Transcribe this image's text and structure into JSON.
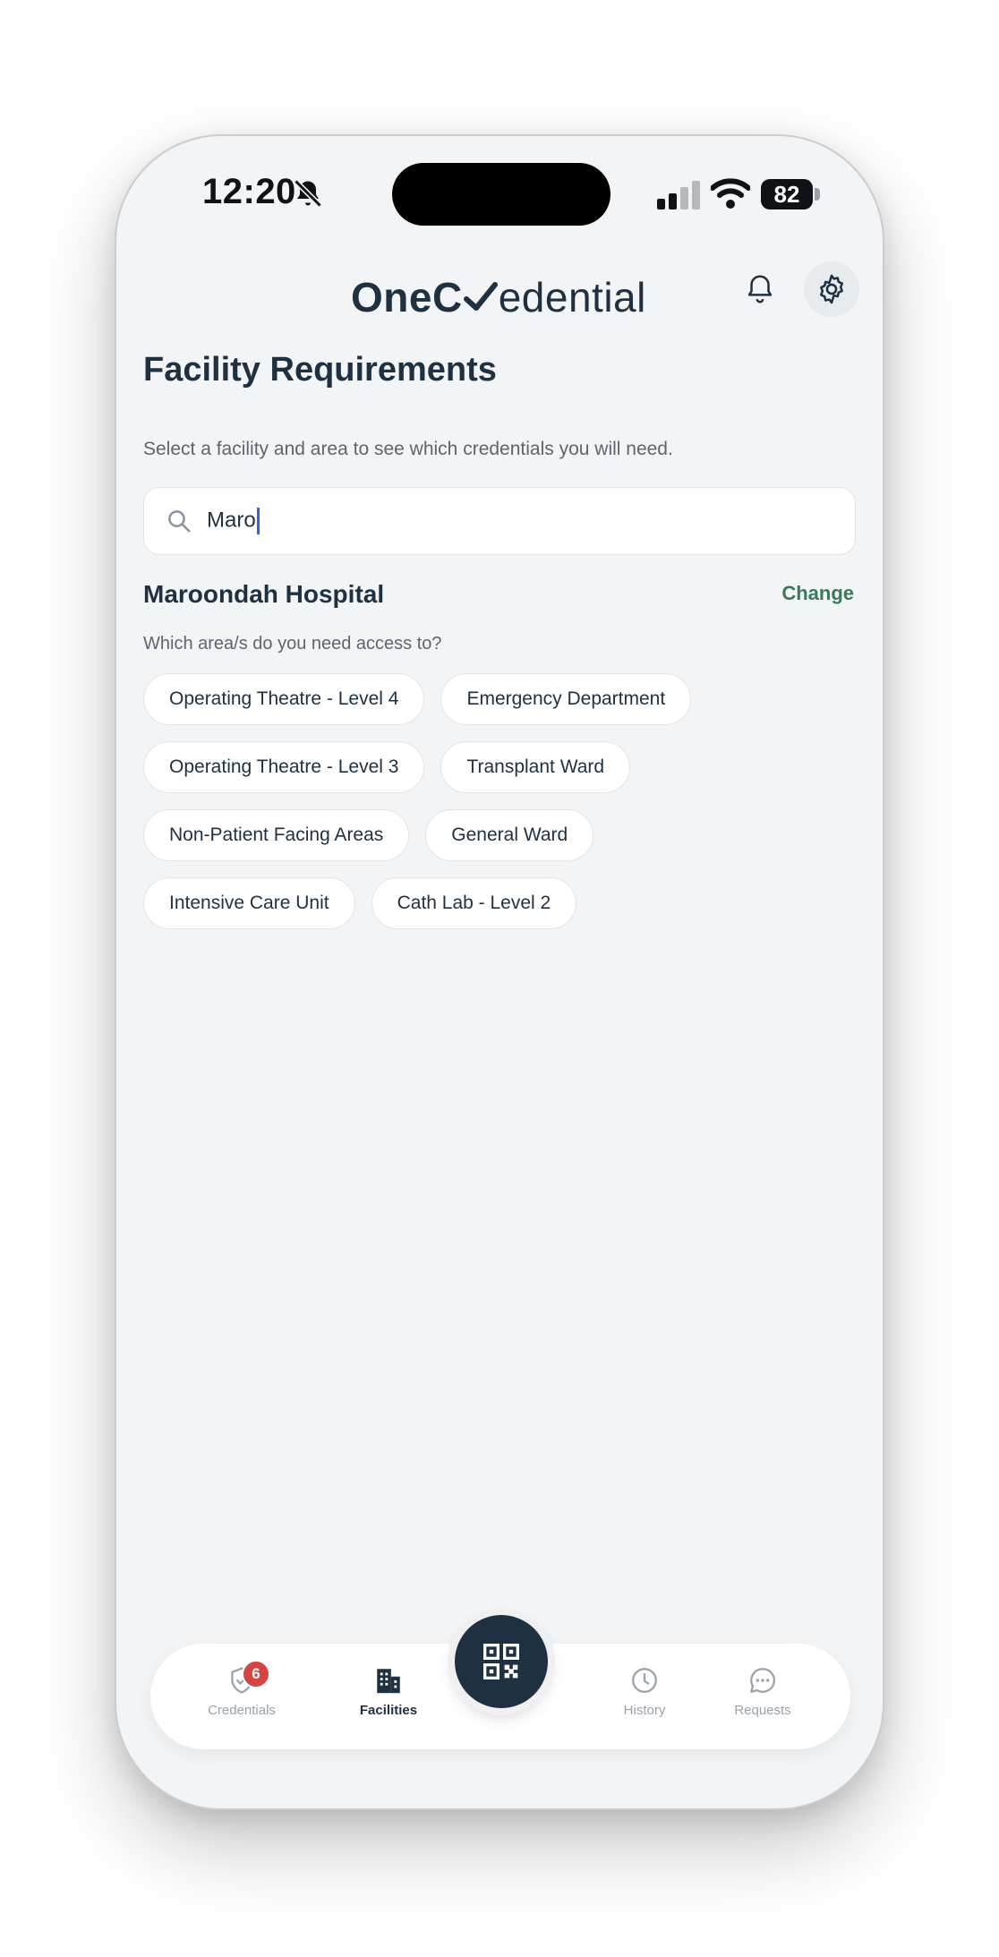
{
  "status_bar": {
    "time": "12:20",
    "battery": "82"
  },
  "header": {
    "logo_part1": "One",
    "logo_part2": "edential",
    "icons": [
      "bell-icon",
      "gear-icon"
    ]
  },
  "page": {
    "title": "Facility Requirements",
    "subtitle": "Select a facility and area to see which credentials you will need."
  },
  "search": {
    "value": "Maro"
  },
  "facility": {
    "name": "Maroondah Hospital",
    "change_label": "Change",
    "question": "Which area/s do you need access to?",
    "areas": [
      [
        "Operating Theatre - Level 4",
        "Emergency Department"
      ],
      [
        "Operating Theatre - Level 3",
        "Transplant Ward"
      ],
      [
        "Non-Patient Facing Areas",
        "General Ward"
      ],
      [
        "Intensive Care Unit",
        "Cath Lab - Level 2"
      ]
    ]
  },
  "tabbar": {
    "credentials": {
      "label": "Credentials",
      "badge": "6"
    },
    "facilities": {
      "label": "Facilities"
    },
    "history": {
      "label": "History"
    },
    "requests": {
      "label": "Requests"
    }
  }
}
